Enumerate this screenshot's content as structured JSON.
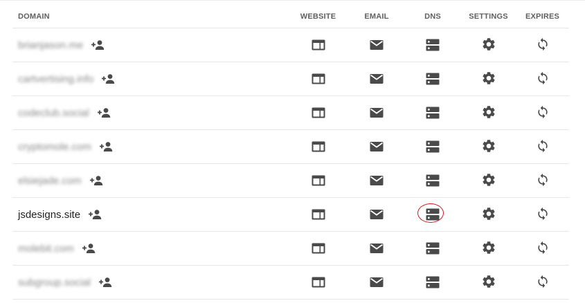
{
  "colors": {
    "icon": "#4a4a4a",
    "header_text": "#5f5f5f",
    "row_divider": "#e6e6e6",
    "highlight_ring": "#d81414"
  },
  "table": {
    "headers": {
      "domain": "DOMAIN",
      "website": "WEBSITE",
      "email": "EMAIL",
      "dns": "DNS",
      "settings": "SETTINGS",
      "expires": "EXPIRES"
    },
    "icons": {
      "website": "website-icon",
      "email": "email-icon",
      "dns": "dns-icon",
      "settings": "gear-icon",
      "expires": "sync-icon",
      "add_user": "person-add-icon"
    },
    "rows": [
      {
        "domain": "brianjason.me",
        "blurred": true
      },
      {
        "domain": "cartvertising.info",
        "blurred": true
      },
      {
        "domain": "codeclub.social",
        "blurred": true
      },
      {
        "domain": "cryptomole.com",
        "blurred": true
      },
      {
        "domain": "elsiejade.com",
        "blurred": true
      },
      {
        "domain": "jsdesigns.site",
        "blurred": false,
        "dns_highlighted": true
      },
      {
        "domain": "molebit.com",
        "blurred": true
      },
      {
        "domain": "subgroup.social",
        "blurred": true
      }
    ]
  }
}
